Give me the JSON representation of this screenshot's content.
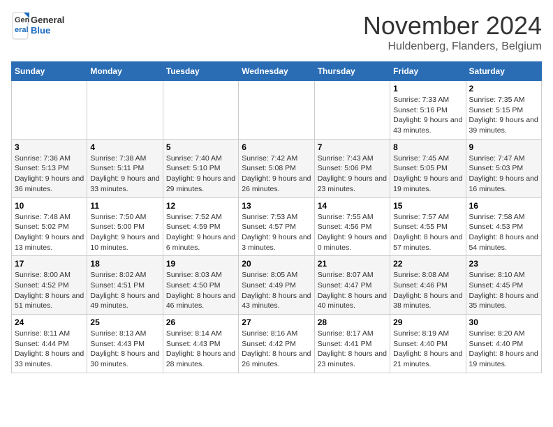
{
  "header": {
    "logo_general": "General",
    "logo_blue": "Blue",
    "month_title": "November 2024",
    "location": "Huldenberg, Flanders, Belgium"
  },
  "days_of_week": [
    "Sunday",
    "Monday",
    "Tuesday",
    "Wednesday",
    "Thursday",
    "Friday",
    "Saturday"
  ],
  "weeks": [
    {
      "days": [
        {
          "number": "",
          "info": ""
        },
        {
          "number": "",
          "info": ""
        },
        {
          "number": "",
          "info": ""
        },
        {
          "number": "",
          "info": ""
        },
        {
          "number": "",
          "info": ""
        },
        {
          "number": "1",
          "info": "Sunrise: 7:33 AM\nSunset: 5:16 PM\nDaylight: 9 hours and 43 minutes."
        },
        {
          "number": "2",
          "info": "Sunrise: 7:35 AM\nSunset: 5:15 PM\nDaylight: 9 hours and 39 minutes."
        }
      ]
    },
    {
      "days": [
        {
          "number": "3",
          "info": "Sunrise: 7:36 AM\nSunset: 5:13 PM\nDaylight: 9 hours and 36 minutes."
        },
        {
          "number": "4",
          "info": "Sunrise: 7:38 AM\nSunset: 5:11 PM\nDaylight: 9 hours and 33 minutes."
        },
        {
          "number": "5",
          "info": "Sunrise: 7:40 AM\nSunset: 5:10 PM\nDaylight: 9 hours and 29 minutes."
        },
        {
          "number": "6",
          "info": "Sunrise: 7:42 AM\nSunset: 5:08 PM\nDaylight: 9 hours and 26 minutes."
        },
        {
          "number": "7",
          "info": "Sunrise: 7:43 AM\nSunset: 5:06 PM\nDaylight: 9 hours and 23 minutes."
        },
        {
          "number": "8",
          "info": "Sunrise: 7:45 AM\nSunset: 5:05 PM\nDaylight: 9 hours and 19 minutes."
        },
        {
          "number": "9",
          "info": "Sunrise: 7:47 AM\nSunset: 5:03 PM\nDaylight: 9 hours and 16 minutes."
        }
      ]
    },
    {
      "days": [
        {
          "number": "10",
          "info": "Sunrise: 7:48 AM\nSunset: 5:02 PM\nDaylight: 9 hours and 13 minutes."
        },
        {
          "number": "11",
          "info": "Sunrise: 7:50 AM\nSunset: 5:00 PM\nDaylight: 9 hours and 10 minutes."
        },
        {
          "number": "12",
          "info": "Sunrise: 7:52 AM\nSunset: 4:59 PM\nDaylight: 9 hours and 6 minutes."
        },
        {
          "number": "13",
          "info": "Sunrise: 7:53 AM\nSunset: 4:57 PM\nDaylight: 9 hours and 3 minutes."
        },
        {
          "number": "14",
          "info": "Sunrise: 7:55 AM\nSunset: 4:56 PM\nDaylight: 9 hours and 0 minutes."
        },
        {
          "number": "15",
          "info": "Sunrise: 7:57 AM\nSunset: 4:55 PM\nDaylight: 8 hours and 57 minutes."
        },
        {
          "number": "16",
          "info": "Sunrise: 7:58 AM\nSunset: 4:53 PM\nDaylight: 8 hours and 54 minutes."
        }
      ]
    },
    {
      "days": [
        {
          "number": "17",
          "info": "Sunrise: 8:00 AM\nSunset: 4:52 PM\nDaylight: 8 hours and 51 minutes."
        },
        {
          "number": "18",
          "info": "Sunrise: 8:02 AM\nSunset: 4:51 PM\nDaylight: 8 hours and 49 minutes."
        },
        {
          "number": "19",
          "info": "Sunrise: 8:03 AM\nSunset: 4:50 PM\nDaylight: 8 hours and 46 minutes."
        },
        {
          "number": "20",
          "info": "Sunrise: 8:05 AM\nSunset: 4:49 PM\nDaylight: 8 hours and 43 minutes."
        },
        {
          "number": "21",
          "info": "Sunrise: 8:07 AM\nSunset: 4:47 PM\nDaylight: 8 hours and 40 minutes."
        },
        {
          "number": "22",
          "info": "Sunrise: 8:08 AM\nSunset: 4:46 PM\nDaylight: 8 hours and 38 minutes."
        },
        {
          "number": "23",
          "info": "Sunrise: 8:10 AM\nSunset: 4:45 PM\nDaylight: 8 hours and 35 minutes."
        }
      ]
    },
    {
      "days": [
        {
          "number": "24",
          "info": "Sunrise: 8:11 AM\nSunset: 4:44 PM\nDaylight: 8 hours and 33 minutes."
        },
        {
          "number": "25",
          "info": "Sunrise: 8:13 AM\nSunset: 4:43 PM\nDaylight: 8 hours and 30 minutes."
        },
        {
          "number": "26",
          "info": "Sunrise: 8:14 AM\nSunset: 4:43 PM\nDaylight: 8 hours and 28 minutes."
        },
        {
          "number": "27",
          "info": "Sunrise: 8:16 AM\nSunset: 4:42 PM\nDaylight: 8 hours and 26 minutes."
        },
        {
          "number": "28",
          "info": "Sunrise: 8:17 AM\nSunset: 4:41 PM\nDaylight: 8 hours and 23 minutes."
        },
        {
          "number": "29",
          "info": "Sunrise: 8:19 AM\nSunset: 4:40 PM\nDaylight: 8 hours and 21 minutes."
        },
        {
          "number": "30",
          "info": "Sunrise: 8:20 AM\nSunset: 4:40 PM\nDaylight: 8 hours and 19 minutes."
        }
      ]
    }
  ]
}
